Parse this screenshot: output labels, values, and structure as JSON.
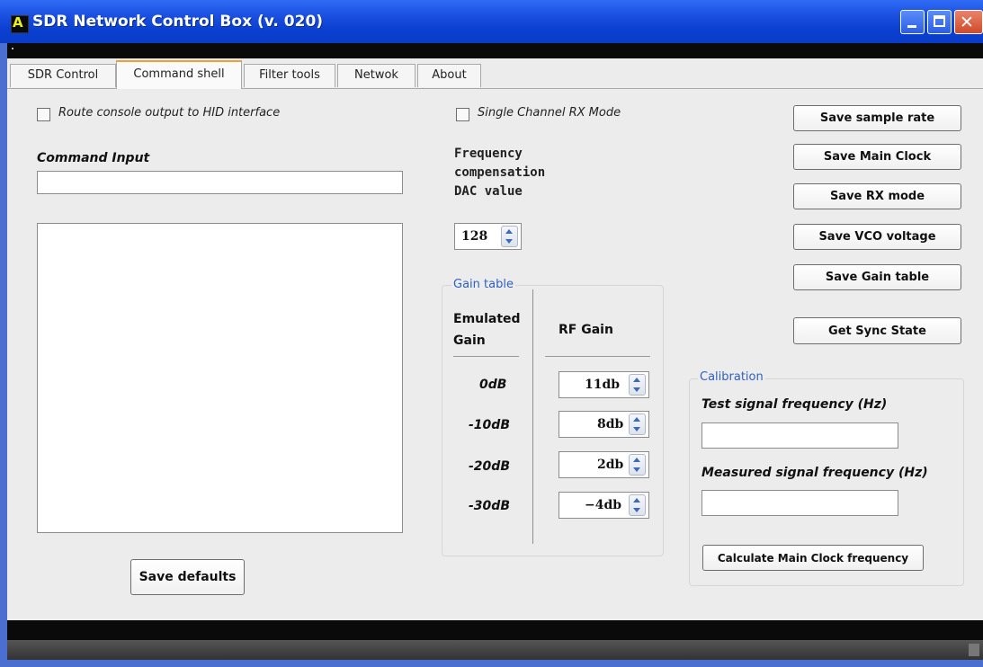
{
  "window": {
    "title": "SDR Network Control Box (v. 020)",
    "icon_text": "A"
  },
  "tabs": [
    {
      "label": "SDR Control"
    },
    {
      "label": "Command shell"
    },
    {
      "label": "Filter tools"
    },
    {
      "label": "Netwok"
    },
    {
      "label": "About"
    }
  ],
  "left": {
    "route_checkbox_label": "Route console output to HID interface",
    "command_input_label": "Command Input",
    "command_input_value": "",
    "console_output": "",
    "save_defaults_label": "Save defaults"
  },
  "middle": {
    "single_channel_label": "Single Channel RX Mode",
    "freq_comp_line1": "Frequency",
    "freq_comp_line2": "compensation",
    "freq_comp_line3": "DAC value",
    "dac_value": "128",
    "gain_group_title": "Gain table",
    "col_emulated_line1": "Emulated",
    "col_emulated_line2": "Gain",
    "col_rf_gain": "RF Gain",
    "rows": [
      {
        "emulated": "0dB",
        "rf": "11db"
      },
      {
        "emulated": "-10dB",
        "rf": "8db"
      },
      {
        "emulated": "-20dB",
        "rf": "2db"
      },
      {
        "emulated": "-30dB",
        "rf": "−4db"
      }
    ]
  },
  "right": {
    "buttons": [
      {
        "label": "Save sample rate"
      },
      {
        "label": "Save Main Clock"
      },
      {
        "label": "Save RX mode"
      },
      {
        "label": "Save VCO voltage"
      },
      {
        "label": "Save Gain table"
      },
      {
        "label": "Get Sync State"
      }
    ],
    "calibration_title": "Calibration",
    "test_signal_label": "Test signal frequency (Hz)",
    "test_signal_value": "",
    "measured_signal_label": "Measured signal frequency (Hz)",
    "measured_signal_value": "",
    "calculate_label": "Calculate Main Clock frequency"
  },
  "colors": {
    "title_bar": "#0a3fd0",
    "active_tab_accent": "#f0a030",
    "group_title": "#3060c0",
    "panel_background": "#ececec"
  }
}
